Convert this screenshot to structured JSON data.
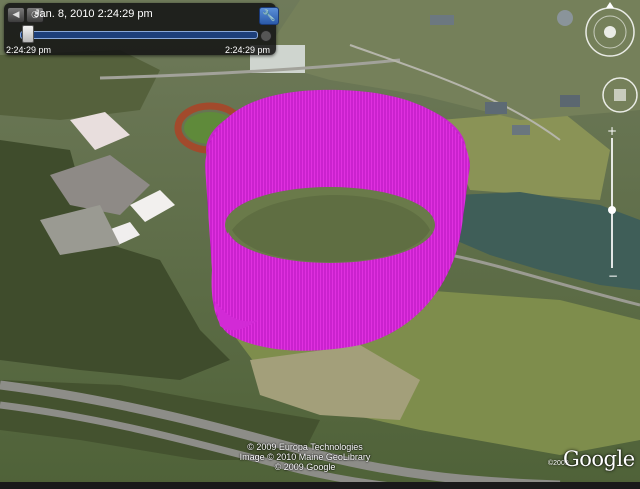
{
  "time_slider": {
    "date_label": "Jan. 8, 2010   2:24:29 pm",
    "start_time": "2:24:29 pm",
    "end_time": "2:24:29 pm",
    "buttons": [
      "back-icon",
      "clock-icon",
      "zoom-out-icon",
      "zoom-in-icon"
    ]
  },
  "settings_button": {
    "icon": "wrench-icon"
  },
  "navigation": {
    "icons": [
      "north-compass-icon",
      "look-joystick-icon",
      "move-joystick-icon",
      "zoom-slider-icon"
    ]
  },
  "attribution": {
    "line1": "© 2009 Europa Technologies",
    "line2": "Image © 2010 Maine GeoLibrary",
    "line3": "© 2009 Google"
  },
  "eye_alt": "©2009",
  "logo_text": "Google",
  "colors": {
    "track_overlay": "#e628e6",
    "nav_controls": "#ffffff"
  }
}
